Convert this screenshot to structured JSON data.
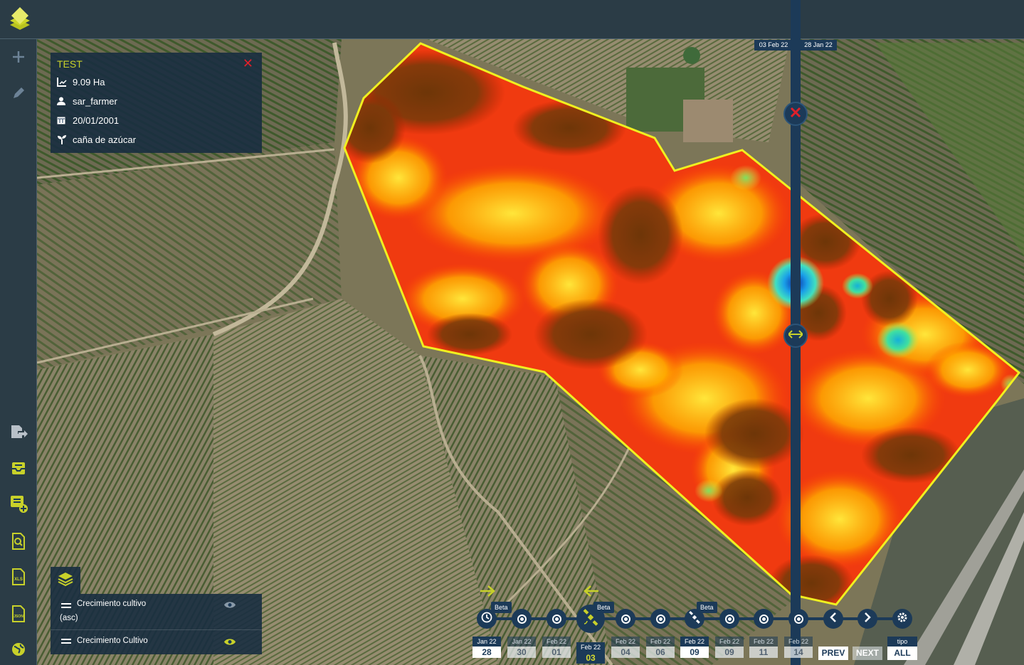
{
  "app": {
    "logo_icon": "stacked-diamond-logo",
    "accent_color": "#c8d12a",
    "panel_color": "#1c3a58"
  },
  "sidebar": {
    "top_items": [
      {
        "icon": "plus-icon"
      },
      {
        "icon": "pencil-icon"
      }
    ],
    "bottom_items": [
      {
        "icon": "file-export-icon"
      },
      {
        "icon": "inbox-report-icon"
      },
      {
        "icon": "add-report-icon"
      },
      {
        "icon": "search-document-icon"
      },
      {
        "icon": "xls-file-icon"
      },
      {
        "icon": "json-file-icon"
      },
      {
        "icon": "globe-icon"
      }
    ]
  },
  "field_info": {
    "title": "TEST",
    "area": "9.09 Ha",
    "owner": "sar_farmer",
    "date": "20/01/2001",
    "crop": "caña de azúcar"
  },
  "layers": {
    "items": [
      {
        "name_line1": "Crecimiento cultivo",
        "name_line2": "(asc)"
      },
      {
        "name_line1": "Crecimiento Cultivo",
        "name_line2": ""
      }
    ]
  },
  "compare": {
    "left_date": "03 Feb 22",
    "right_date": "28 Jan 22"
  },
  "timeline": {
    "beta_label": "Beta",
    "dates": [
      {
        "month": "Jan 22",
        "day": "28"
      },
      {
        "month": "Jan 22",
        "day": "30"
      },
      {
        "month": "Feb 22",
        "day": "01"
      },
      {
        "month": "Feb 22",
        "day": "03"
      },
      {
        "month": "Feb 22",
        "day": "04"
      },
      {
        "month": "Feb 22",
        "day": "06"
      },
      {
        "month": "Feb 22",
        "day": "09"
      },
      {
        "month": "Feb 22",
        "day": "09"
      },
      {
        "month": "Feb 22",
        "day": "11"
      },
      {
        "month": "Feb 22",
        "day": "14"
      }
    ],
    "prev_label": "PREV",
    "next_label": "NEXT",
    "tipo_label": "tipo",
    "all_label": "ALL"
  }
}
